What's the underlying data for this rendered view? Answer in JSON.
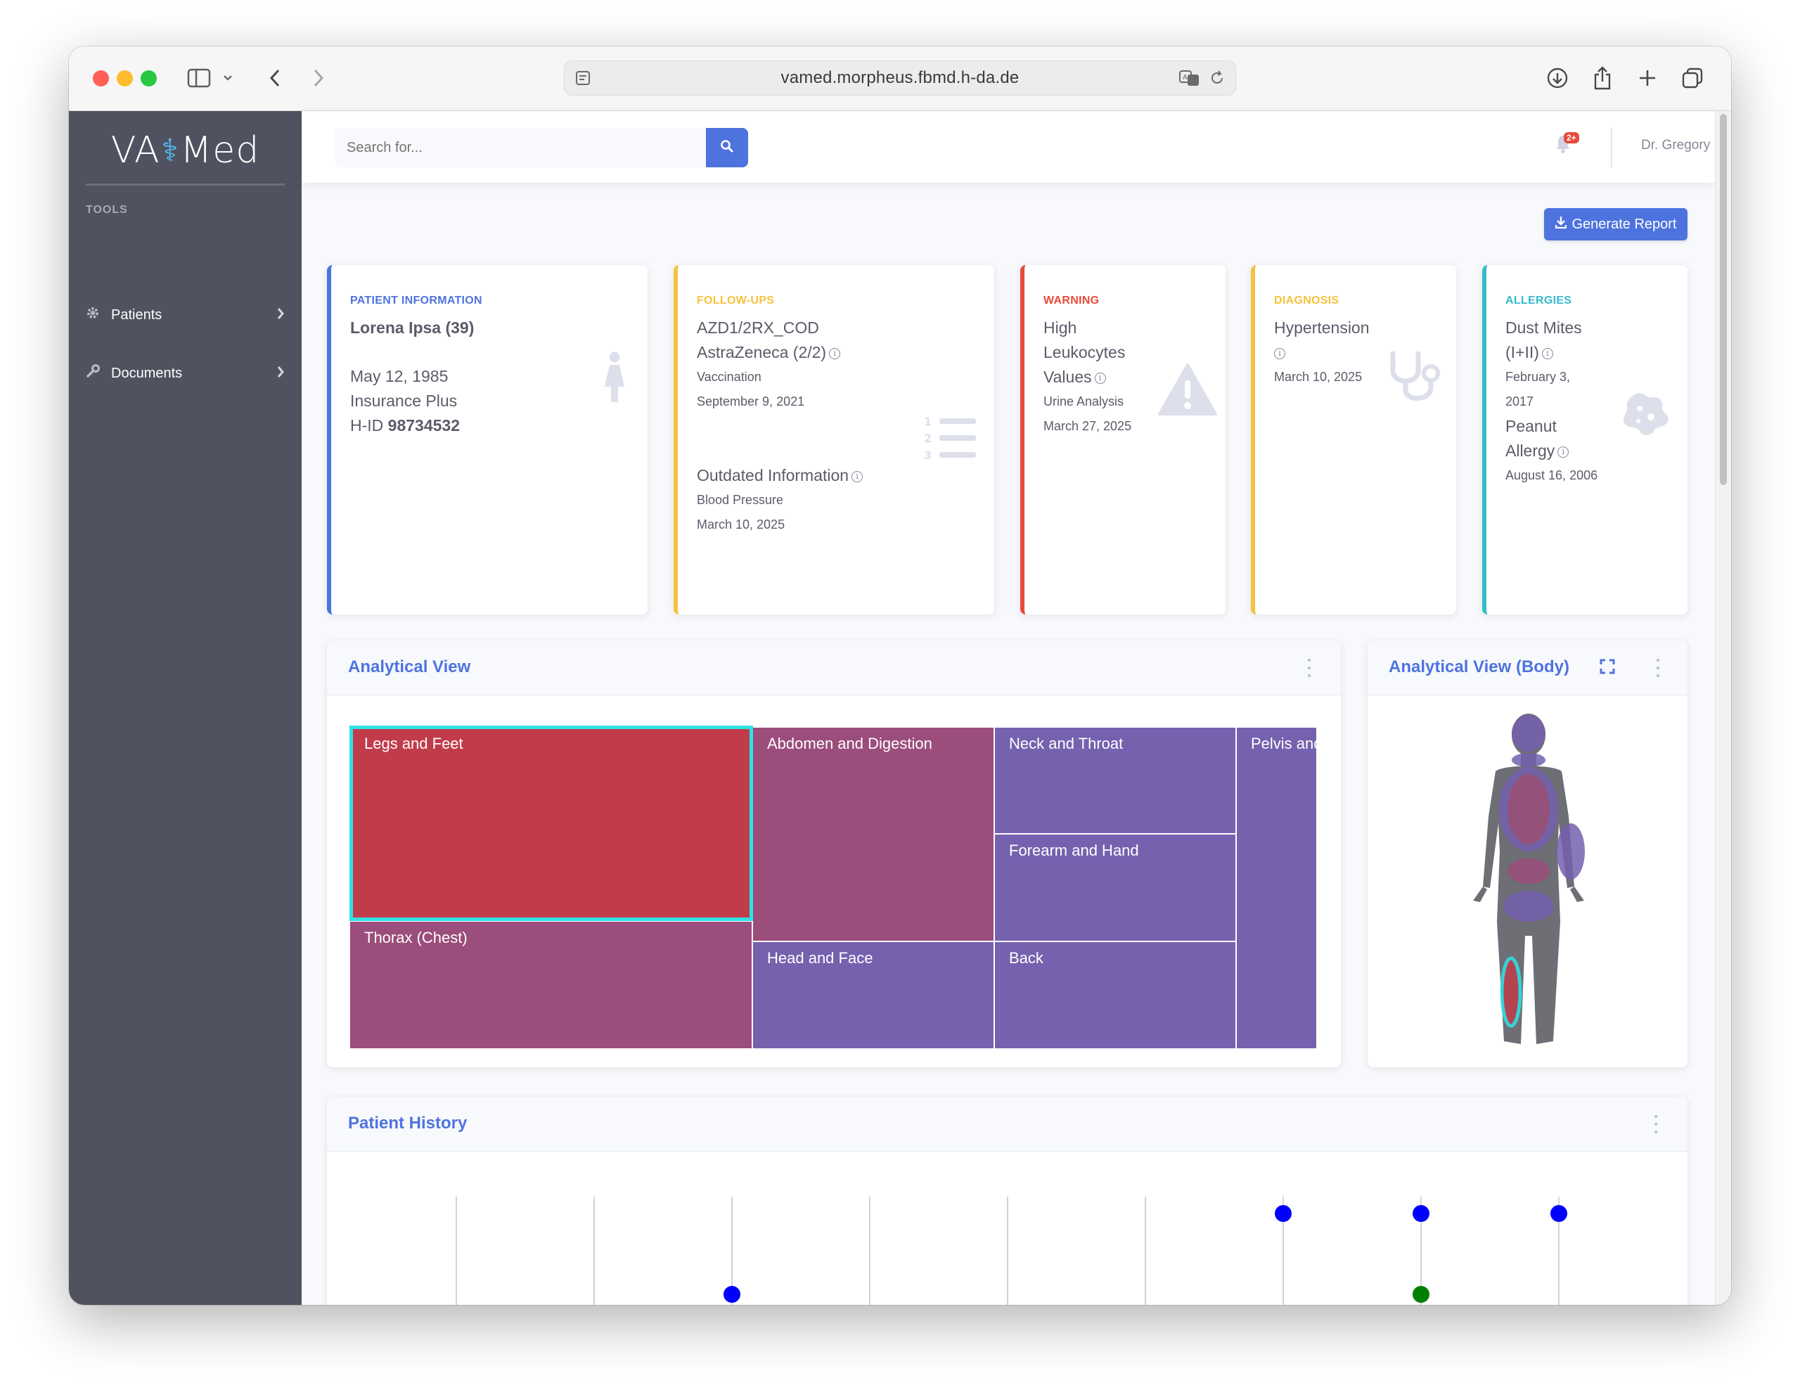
{
  "browser": {
    "url": "vamed.morpheus.fbmd.h-da.de"
  },
  "sidebar": {
    "brand_left": "VA",
    "brand_right": "Med",
    "heading": "TOOLS",
    "items": [
      {
        "label": "Patients",
        "icon": "gear-icon"
      },
      {
        "label": "Documents",
        "icon": "wrench-icon"
      }
    ]
  },
  "topbar": {
    "search_placeholder": "Search for...",
    "notification_badge": "2+",
    "user_name": "Dr. Gregory"
  },
  "actions": {
    "generate_report": "Generate Report"
  },
  "cards": {
    "patient": {
      "label": "PATIENT INFORMATION",
      "name": "Lorena Ipsa (39)",
      "dob": "May 12, 1985",
      "insurance": "Insurance Plus",
      "hid_prefix": "H-ID",
      "hid_value": "98734532",
      "color": "#4e73df"
    },
    "followups": {
      "label": "FOLLOW-UPS",
      "item1_title_a": "AZD1/2RX_COD",
      "item1_title_b": "AstraZeneca (2/2)",
      "item1_type": "Vaccination",
      "item1_date": "September 9, 2021",
      "item2_title": "Outdated Information",
      "item2_type": "Blood Pressure",
      "item2_date": "March 10, 2025",
      "color": "#f6c23e"
    },
    "warning": {
      "label": "WARNING",
      "title_a": "High",
      "title_b": "Leukocytes",
      "title_c": "Values",
      "source": "Urine Analysis",
      "date": "March 27, 2025",
      "color": "#e74a3b"
    },
    "diagnosis": {
      "label": "DIAGNOSIS",
      "title": "Hypertension",
      "date": "March 10, 2025",
      "color": "#f6c23e"
    },
    "allergies": {
      "label": "ALLERGIES",
      "item1_a": "Dust Mites",
      "item1_b": "(I+II)",
      "item1_date_a": "February 3,",
      "item1_date_b": "2017",
      "item2_a": "Peanut",
      "item2_b": "Allergy",
      "item2_date": "August 16, 2006",
      "color": "#36b9cc"
    }
  },
  "analytical_view": {
    "title": "Analytical View",
    "regions": [
      {
        "label": "Legs and Feet",
        "color": "#c13c4a",
        "selected": true
      },
      {
        "label": "Abdomen and Digestion",
        "color": "#9b4d7b"
      },
      {
        "label": "Neck and Throat",
        "color": "#7561ae"
      },
      {
        "label": "Pelvis and Hips",
        "color": "#7561ae"
      },
      {
        "label": "Forearm and Hand",
        "color": "#7561ae"
      },
      {
        "label": "Thorax (Chest)",
        "color": "#9b4d7b"
      },
      {
        "label": "Head and Face",
        "color": "#7561ae"
      },
      {
        "label": "Back",
        "color": "#7561ae"
      }
    ],
    "selection_color": "#2de2e6"
  },
  "body_view": {
    "title": "Analytical View (Body)"
  },
  "history": {
    "title": "Patient History"
  }
}
